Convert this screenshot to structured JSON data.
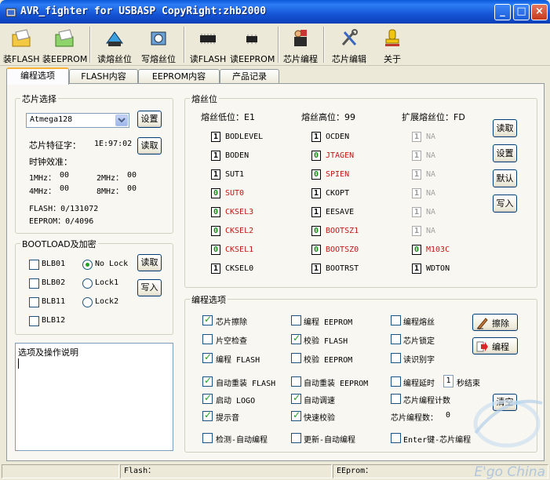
{
  "window": {
    "title": "AVR_fighter for USBASP CopyRight:zhb2000"
  },
  "toolbar": {
    "load_flash": "装FLASH",
    "load_eeprom": "装EEPROM",
    "read_fuse": "读熔丝位",
    "write_fuse": "写熔丝位",
    "read_flash": "读FLASH",
    "read_eeprom": "读EEPROM",
    "chip_program": "芯片编程",
    "chip_edit": "芯片编辑",
    "about": "关于"
  },
  "tabs": [
    "编程选项",
    "FLASH内容",
    "EEPROM内容",
    "产品记录"
  ],
  "chip": {
    "group_title": "芯片选择",
    "selected": "Atmega128",
    "set_button": "设置",
    "read_button": "读取",
    "signature_label": "芯片特征字：",
    "signature": "1E:97:02",
    "calib_label": "时钟效准：",
    "calib": [
      {
        "label": "1MHz：",
        "value": "00"
      },
      {
        "label": "2MHz：",
        "value": "00"
      },
      {
        "label": "4MHz：",
        "value": "00"
      },
      {
        "label": "8MHz：",
        "value": "00"
      }
    ],
    "flash_line": "FLASH：0/131072",
    "eeprom_line": "EEPROM：0/4096"
  },
  "bootload": {
    "group_title": "BOOTLOAD及加密",
    "blb": [
      "BLB01",
      "BLB02",
      "BLB11",
      "BLB12"
    ],
    "locks": [
      "No Lock",
      "Lock1",
      "Lock2"
    ],
    "read_button": "读取",
    "write_button": "写入"
  },
  "notes": {
    "title": "选项及操作说明"
  },
  "fuses": {
    "group_title": "熔丝位",
    "low_header": "熔丝低位：E1",
    "high_header": "熔丝高位：99",
    "ext_header": "扩展熔丝位：FD",
    "low": [
      {
        "v": "1",
        "name": "BODLEVEL"
      },
      {
        "v": "1",
        "name": "BODEN"
      },
      {
        "v": "1",
        "name": "SUT1"
      },
      {
        "v": "0",
        "name": "SUT0"
      },
      {
        "v": "0",
        "name": "CKSEL3"
      },
      {
        "v": "0",
        "name": "CKSEL2"
      },
      {
        "v": "0",
        "name": "CKSEL1"
      },
      {
        "v": "1",
        "name": "CKSEL0"
      }
    ],
    "high": [
      {
        "v": "1",
        "name": "OCDEN"
      },
      {
        "v": "0",
        "name": "JTAGEN"
      },
      {
        "v": "0",
        "name": "SPIEN"
      },
      {
        "v": "1",
        "name": "CKOPT"
      },
      {
        "v": "1",
        "name": "EESAVE"
      },
      {
        "v": "0",
        "name": "BOOTSZ1"
      },
      {
        "v": "0",
        "name": "BOOTSZ0"
      },
      {
        "v": "1",
        "name": "BOOTRST"
      }
    ],
    "ext": [
      {
        "v": "1",
        "name": "NA"
      },
      {
        "v": "1",
        "name": "NA"
      },
      {
        "v": "1",
        "name": "NA"
      },
      {
        "v": "1",
        "name": "NA"
      },
      {
        "v": "1",
        "name": "NA"
      },
      {
        "v": "1",
        "name": "NA"
      },
      {
        "v": "0",
        "name": "M103C"
      },
      {
        "v": "1",
        "name": "WDTON"
      }
    ],
    "read_button": "读取",
    "set_button": "设置",
    "default_button": "默认",
    "write_button": "写入"
  },
  "prog": {
    "group_title": "编程选项",
    "chip_erase": "芯片擦除",
    "prog_eeprom": "编程 EEPROM",
    "prog_fuse": "编程熔丝",
    "blank_check": "片空检查",
    "verify_flash": "校验 FLASH",
    "chip_lock": "芯片锁定",
    "prog_flash": "编程 FLASH",
    "verify_eeprom": "校验 EEPROM",
    "read_sig": "读识别字",
    "auto_reload_flash": "自动重装 FLASH",
    "auto_reload_eeprom": "自动重装 EEPROM",
    "delay_prefix": "编程延时",
    "delay_value": "1",
    "delay_suffix": "秒结束",
    "start_logo": "启动 LOGO",
    "auto_speed": "自动调速",
    "chip_count": "芯片编程计数",
    "beep": "提示音",
    "fast_verify": "快速校验",
    "count_label": "芯片编程数：",
    "count_value": "0",
    "detect_auto": "检测-自动编程",
    "update_auto": "更新-自动编程",
    "enter_prog": "Enter键-芯片编程",
    "erase_button": "擦除",
    "program_button": "编程",
    "clear_button": "清空"
  },
  "status": {
    "flash": "Flash：",
    "eeprom": "EEprom："
  },
  "watermark": "E'go China"
}
